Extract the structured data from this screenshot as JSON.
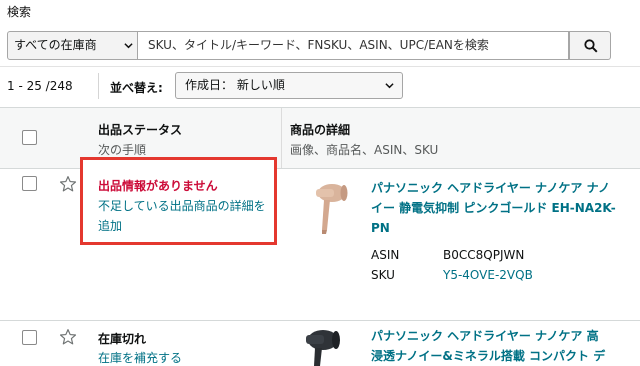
{
  "search": {
    "label": "検索",
    "scope": "すべての在庫商",
    "placeholder": "SKU、タイトル/キーワード、FNSKU、ASIN、UPC/EANを検索"
  },
  "toolbar": {
    "range": "1 - 25 /248",
    "sort_label": "並べ替え:",
    "sort_value": "作成日： 新しい順"
  },
  "table": {
    "headers": {
      "status": "出品ステータス",
      "next_step": "次の手順",
      "details": "商品の詳細",
      "details_sub": "画像、商品名、ASIN、SKU"
    },
    "rows": [
      {
        "status": "出品情報がありません",
        "action": "不足している出品商品の詳細を追加",
        "title_line1": "パナソニック ヘアドライヤー ナノケア ナノ",
        "title_line2": "イー 静電気抑制 ピンクゴールド EH-NA2K-",
        "title_line3": "PN",
        "asin_label": "ASIN",
        "asin": "B0CC8QPJWN",
        "sku_label": "SKU",
        "sku": "Y5-4OVE-2VQB"
      },
      {
        "status": "在庫切れ",
        "action": "在庫を補充する",
        "title_line1": "パナソニック ヘアドライヤー ナノケア 高",
        "title_line2": "浸透ナノイー&ミネラル搭載 コンパクト デ"
      }
    ]
  },
  "colors": {
    "link": "#007185",
    "warning_border": "#e4382f",
    "warning_text": "#cc0c39"
  },
  "icons": [
    "chevron-down-icon",
    "search-icon",
    "star-icon",
    "checkbox"
  ]
}
